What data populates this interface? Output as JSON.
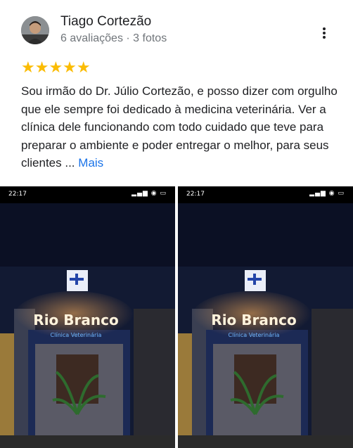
{
  "review": {
    "author": "Tiago Cortezão",
    "meta": "6 avaliações · 3 fotos",
    "stars": "★★★★★",
    "rating": 5,
    "text": "Sou irmão do Dr. Júlio Cortezão, e posso dizer com orgulho que ele sempre foi  dedicado à medicina veterinária. Ver a clínica dele funcionando com todo cuidado que teve para preparar o ambiente e poder entregar o melhor, para seus clientes ...",
    "more_label": "Mais"
  },
  "photos": [
    {
      "status_time": "22:17",
      "sign_title": "Rio Branco",
      "sign_subtitle": "Clínica Veterinária"
    },
    {
      "status_time": "22:17",
      "sign_title": "Rio Branco",
      "sign_subtitle": "Clínica Veterinária"
    }
  ],
  "colors": {
    "star": "#fbbc04",
    "link": "#1a73e8",
    "sign_glow": "#ffb15a"
  }
}
